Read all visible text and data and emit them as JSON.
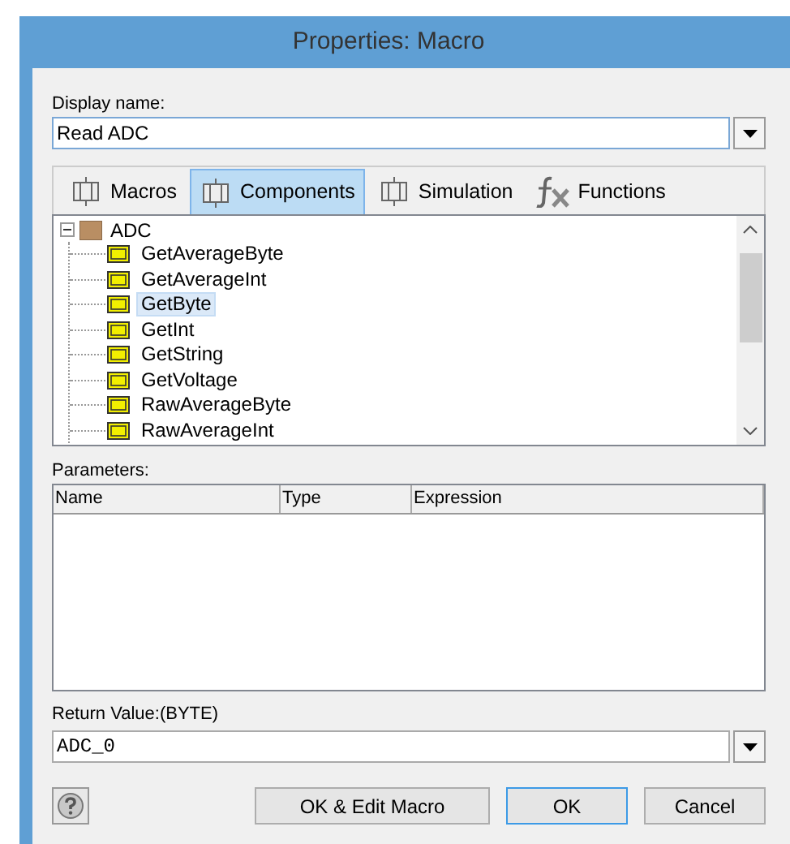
{
  "window": {
    "title": "Properties: Macro"
  },
  "display_name": {
    "label": "Display name:",
    "value": "Read ADC"
  },
  "tabs": [
    {
      "label": "Macros",
      "selected": false,
      "kind": "component"
    },
    {
      "label": "Components",
      "selected": true,
      "kind": "component"
    },
    {
      "label": "Simulation",
      "selected": false,
      "kind": "component"
    },
    {
      "label": "Functions",
      "selected": false,
      "kind": "fx"
    }
  ],
  "tree": [
    {
      "label": "ADC",
      "expanded": true,
      "children": [
        {
          "label": "GetAverageByte",
          "selected": false
        },
        {
          "label": "GetAverageInt",
          "selected": false
        },
        {
          "label": "GetByte",
          "selected": true
        },
        {
          "label": "GetInt",
          "selected": false
        },
        {
          "label": "GetString",
          "selected": false
        },
        {
          "label": "GetVoltage",
          "selected": false
        },
        {
          "label": "RawAverageByte",
          "selected": false
        },
        {
          "label": "RawAverageInt",
          "selected": false
        }
      ]
    }
  ],
  "parameters": {
    "label": "Parameters:",
    "columns": [
      "Name",
      "Type",
      "Expression"
    ]
  },
  "return_value": {
    "label": "Return Value:(BYTE)",
    "value": "ADC_0"
  },
  "buttons": [
    {
      "label": "OK & Edit Macro",
      "default": false
    },
    {
      "label": "OK",
      "default": true
    },
    {
      "label": "Cancel",
      "default": false
    }
  ]
}
